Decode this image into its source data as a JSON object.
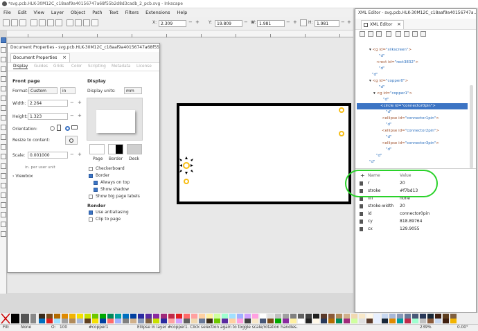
{
  "window": {
    "title": "*svg.pcb.HLK-30M12C_c18aaf9a40156747a68f55b2d8d3cadb_2_pcb.svg - Inkscape"
  },
  "menubar": [
    "File",
    "Edit",
    "View",
    "Layer",
    "Object",
    "Path",
    "Text",
    "Filters",
    "Extensions",
    "Help"
  ],
  "toolbar": {
    "x_label": "X:",
    "x_value": "2.309",
    "y_label": "Y:",
    "y_value": "19.809",
    "w_label": "W:",
    "w_value": "1.981",
    "h_label": "H:",
    "h_value": "1.981",
    "minus": "−",
    "plus": "+"
  },
  "document_properties": {
    "window_title": "Document Properties - svg.pcb.HLK-30M12C_c18aaf9a40156747a68f55b2d...",
    "tab_label": "Document Properties",
    "subtabs": [
      "Display",
      "Guides",
      "Grids",
      "Color",
      "Scripting",
      "Metadata",
      "License"
    ],
    "front_page_heading": "Front page",
    "format_label": "Format:",
    "format_value": "Custom",
    "format_unit": "in",
    "width_label": "Width:",
    "width_value": "2.264",
    "height_label": "Height:",
    "height_value": "1.323",
    "orientation_label": "Orientation:",
    "resize_label": "Resize to content:",
    "scale_label": "Scale:",
    "scale_value": "0.001000",
    "per_user_unit": "in. per user unit",
    "viewbox_label": "Viewbox",
    "display_heading": "Display",
    "display_units_label": "Display units:",
    "display_units_value": "mm",
    "page_label": "Page",
    "border_label": "Border",
    "desk_label": "Desk",
    "checkerboard": "Checkerboard",
    "border": "Border",
    "always_on_top": "Always on top",
    "show_shadow": "Show shadow",
    "show_big_page_labels": "Show big page labels",
    "render_heading": "Render",
    "use_antialiasing": "Use antialiasing",
    "clip_to_page": "Clip to page"
  },
  "xml_editor": {
    "window_title": "XML Editor - svg.pcb.HLK-30M12C_c18aaf9a40156747a...",
    "tab_label": "XML Editor",
    "nodes": [
      {
        "tag": "<g id=",
        "val": "\"silkscreen\"",
        "tail": ">"
      },
      {
        "tag": "",
        "val": "\"d\"",
        "tail": ""
      },
      {
        "tag": "<rect id=",
        "val": "\"rect3832\"",
        "tail": ">"
      },
      {
        "tag": "",
        "val": "\"d\"",
        "tail": ""
      },
      {
        "tag": "",
        "val": "\"d\"",
        "tail": ""
      },
      {
        "tag": "<g id=",
        "val": "\"copper0\"",
        "tail": ">"
      },
      {
        "tag": "",
        "val": "\"d\"",
        "tail": ""
      },
      {
        "tag": "<g id=",
        "val": "\"copper1\"",
        "tail": ">"
      },
      {
        "tag": "",
        "val": "\"d\"",
        "tail": ""
      },
      {
        "tag": "<circle id=",
        "val": "\"connector0pin\"",
        "tail": ">"
      },
      {
        "tag": "",
        "val": "\"d\"",
        "tail": ""
      },
      {
        "tag": "<ellipse id=",
        "val": "\"connector1pin\"",
        "tail": ">"
      },
      {
        "tag": "",
        "val": "\"d\"",
        "tail": ""
      },
      {
        "tag": "<ellipse id=",
        "val": "\"connector2pin\"",
        "tail": ">"
      },
      {
        "tag": "",
        "val": "\"d\"",
        "tail": ""
      },
      {
        "tag": "<ellipse id=",
        "val": "\"connector3pin\"",
        "tail": ">"
      },
      {
        "tag": "",
        "val": "\"d\"",
        "tail": ""
      },
      {
        "tag": "",
        "val": "\"d\"",
        "tail": ""
      },
      {
        "tag": "",
        "val": "\"d\"",
        "tail": ""
      }
    ],
    "attr_header_name": "Name",
    "attr_header_value": "Value",
    "attributes": [
      {
        "name": "r",
        "value": "20"
      },
      {
        "name": "stroke",
        "value": "#f7bd13"
      },
      {
        "name": "fill",
        "value": "none"
      },
      {
        "name": "stroke-width",
        "value": "20"
      },
      {
        "name": "id",
        "value": "connector0pin"
      },
      {
        "name": "cy",
        "value": "818.89764"
      },
      {
        "name": "cx",
        "value": "129.9055"
      }
    ]
  },
  "statusbar": {
    "fill_label": "Fill:",
    "fill_value": "None",
    "opacity_label": "O:",
    "opacity_value": "100",
    "layer": "#copper1",
    "message": "Ellipse in layer #copper1. Click selection again to toggle scale/rotation handles.",
    "zoom": "239%",
    "rotation": "0.00°"
  },
  "colors": {
    "accent": "#3c74c4",
    "connector": "#f7bd13",
    "highlight": "#2ad22a"
  }
}
